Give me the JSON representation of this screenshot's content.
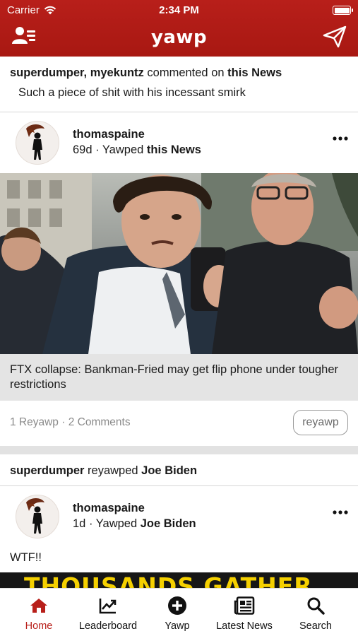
{
  "status_bar": {
    "carrier": "Carrier",
    "time": "2:34 PM"
  },
  "header": {
    "title": "yawp"
  },
  "activity_1": {
    "actors": "superdumper, myekuntz",
    "verb": "commented on",
    "target": "this News",
    "comment": "Such a piece of shit with his incessant smirk"
  },
  "post_1": {
    "username": "thomaspaine",
    "age": "69d",
    "action": "Yawped",
    "target": "this News",
    "headline": "FTX collapse: Bankman-Fried may get flip phone under tougher restrictions",
    "reyawp_count": "1 Reyawp",
    "comment_count": "2 Comments",
    "reyawp_button": "reyawp"
  },
  "activity_2": {
    "actor": "superdumper",
    "verb": "reyawped",
    "target": "Joe Biden"
  },
  "post_2": {
    "username": "thomaspaine",
    "age": "1d",
    "action": "Yawped",
    "target": "Joe Biden",
    "text": "WTF!!",
    "banner_text": "THOUSANDS GATHER"
  },
  "tabbar": {
    "items": [
      {
        "label": "Home",
        "icon": "home-icon",
        "active": true
      },
      {
        "label": "Leaderboard",
        "icon": "chart-icon",
        "active": false
      },
      {
        "label": "Yawp",
        "icon": "plus-circle-icon",
        "active": false
      },
      {
        "label": "Latest News",
        "icon": "newspaper-icon",
        "active": false
      },
      {
        "label": "Search",
        "icon": "search-icon",
        "active": false
      }
    ]
  },
  "colors": {
    "brand": "#b81f1a",
    "active_tab": "#b81f1a",
    "caption_bg": "#e4e4e4"
  }
}
